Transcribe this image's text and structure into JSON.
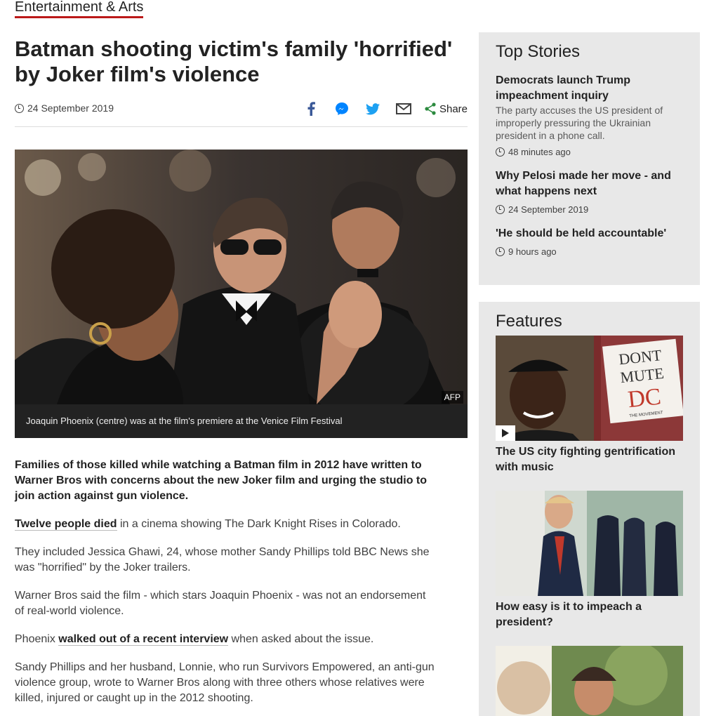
{
  "section": {
    "label": "Entertainment & Arts"
  },
  "article": {
    "headline": "Batman shooting victim's family 'horrified' by Joker film's violence",
    "date": "24 September 2019",
    "share_label": "Share",
    "image_credit": "AFP",
    "image_caption": "Joaquin Phoenix (centre) was at the film's premiere at the Venice Film Festival",
    "lead": "Families of those killed while watching a Batman film in 2012 have written to Warner Bros with concerns about the new Joker film and urging the studio to join action against gun violence.",
    "p1_link": "Twelve people died",
    "p1_rest": " in a cinema showing The Dark Knight Rises in Colorado.",
    "p2": "They included Jessica Ghawi, 24, whose mother Sandy Phillips told BBC News she was \"horrified\" by the Joker trailers.",
    "p3": "Warner Bros said the film - which stars Joaquin Phoenix - was not an endorsement of real-world violence.",
    "p4_start": "Phoenix ",
    "p4_link": "walked out of a recent interview",
    "p4_rest": " when asked about the issue.",
    "p5": "Sandy Phillips and her husband, Lonnie, who run Survivors Empowered, an anti-gun violence group, wrote to Warner Bros along with three others whose relatives were killed, injured or caught up in the 2012 shooting."
  },
  "top_stories": {
    "title": "Top Stories",
    "items": [
      {
        "title": "Democrats launch Trump impeachment inquiry",
        "summary": "The party accuses the US president of improperly pressuring the Ukrainian president in a phone call.",
        "time": "48 minutes ago"
      },
      {
        "title": "Why Pelosi made her move - and what happens next",
        "summary": "",
        "time": "24 September 2019"
      },
      {
        "title": "'He should be held accountable'",
        "summary": "",
        "time": "9 hours ago"
      }
    ]
  },
  "features": {
    "title": "Features",
    "items": [
      {
        "title": "The US city fighting gentrification with music",
        "sign_text_1": "DONT",
        "sign_text_2": "MUTE",
        "sign_text_3": "DC",
        "sign_small": "THE MOVEMENT"
      },
      {
        "title": "How easy is it to impeach a president?"
      },
      {
        "title": ""
      }
    ]
  },
  "colors": {
    "accent": "#bb1919",
    "panel_bg": "#e8e8e8",
    "facebook": "#3b5998",
    "messenger": "#0084ff",
    "twitter": "#1da1f2",
    "share_green": "#2b8a3e"
  }
}
